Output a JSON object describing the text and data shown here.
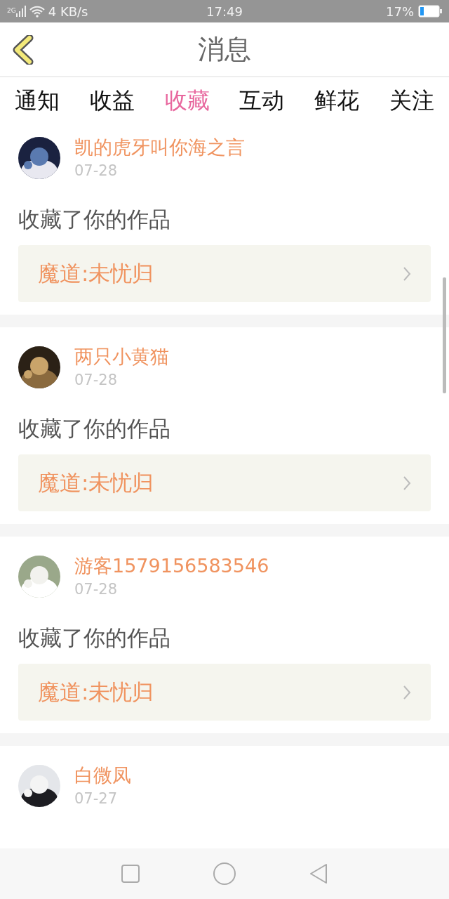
{
  "status_bar": {
    "network": "2G",
    "speed": "4 KB/s",
    "time": "17:49",
    "battery": "17%"
  },
  "header": {
    "title": "消息"
  },
  "tabs": [
    {
      "label": "通知",
      "selected": false
    },
    {
      "label": "收益",
      "selected": false
    },
    {
      "label": "收藏",
      "selected": true
    },
    {
      "label": "互动",
      "selected": false
    },
    {
      "label": "鲜花",
      "selected": false
    },
    {
      "label": "关注",
      "selected": false
    }
  ],
  "messages": [
    {
      "user": "凯的虎牙叫你海之言",
      "date": "07-28",
      "action": "收藏了你的作品",
      "work": "魔道:未忧归"
    },
    {
      "user": "两只小黄猫",
      "date": "07-28",
      "action": "收藏了你的作品",
      "work": "魔道:未忧归"
    },
    {
      "user": "游客1579156583546",
      "date": "07-28",
      "action": "收藏了你的作品",
      "work": "魔道:未忧归"
    },
    {
      "user": "白微凤",
      "date": "07-27"
    }
  ]
}
